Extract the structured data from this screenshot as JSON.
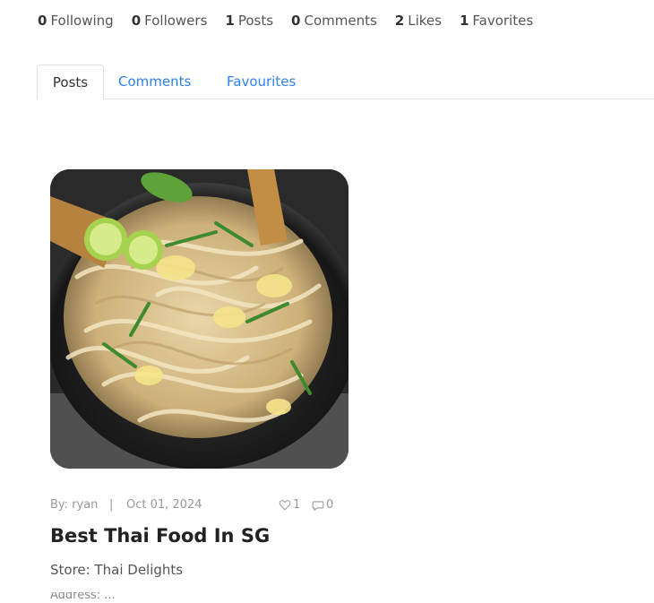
{
  "stats": [
    {
      "count": "0",
      "label": "Following"
    },
    {
      "count": "0",
      "label": "Followers"
    },
    {
      "count": "1",
      "label": "Posts"
    },
    {
      "count": "0",
      "label": "Comments"
    },
    {
      "count": "2",
      "label": "Likes"
    },
    {
      "count": "1",
      "label": "Favorites"
    }
  ],
  "tabs": [
    {
      "label": "Posts",
      "active": true
    },
    {
      "label": "Comments",
      "active": false
    },
    {
      "label": "Favourites",
      "active": false
    }
  ],
  "post": {
    "image_alt": "Thai noodles in a skillet",
    "author": "By: ryan",
    "separator": "|",
    "date": "Oct 01, 2024",
    "likes": "1",
    "comments": "0",
    "title": "Best Thai Food In SG",
    "store": "Store: Thai Delights",
    "truncated": "Address: ..."
  },
  "icons": {
    "heart": "heart-outline-icon",
    "comment": "comment-bubble-icon"
  },
  "colors": {
    "link": "#2f80ed",
    "text": "#333333",
    "muted": "#9a9a9a",
    "border": "#dee2e6"
  }
}
